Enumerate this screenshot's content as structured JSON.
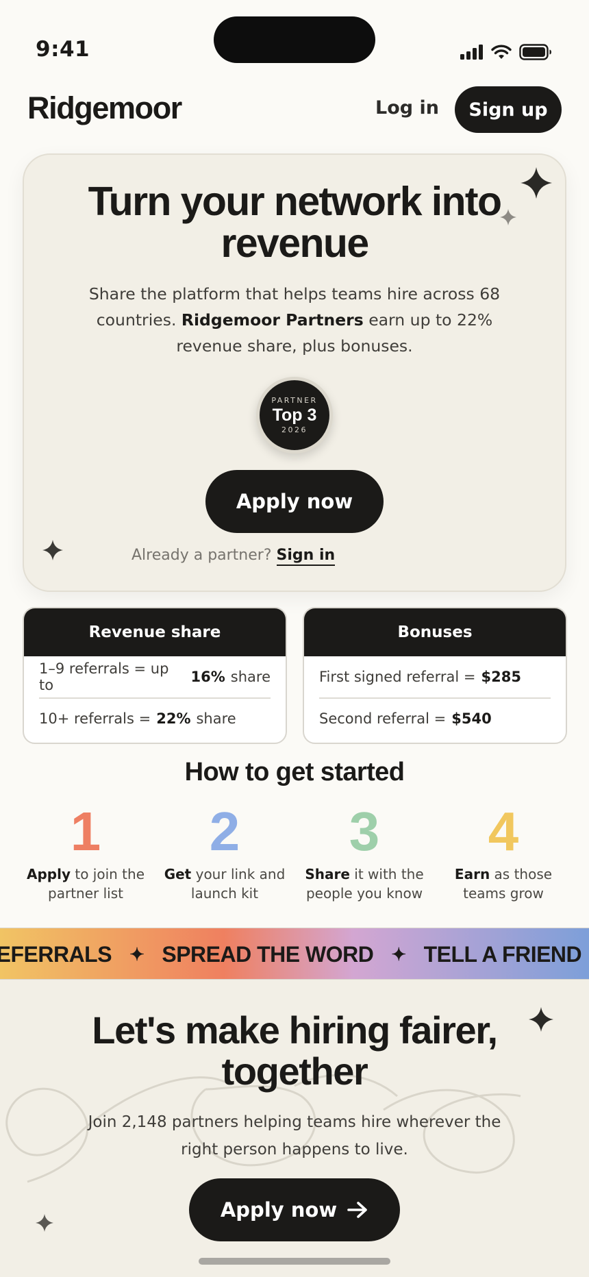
{
  "status": {
    "time": "9:41"
  },
  "header": {
    "logo": "Ridgemoor",
    "login": "Log in",
    "signup": "Sign up"
  },
  "hero": {
    "title_line1": "Turn your network into",
    "title_line2": "revenue",
    "desc_part1": "Share the platform that helps teams hire across 68 countries.",
    "desc_bold": "Ridgemoor Partners",
    "desc_part2": "earn up to 22% revenue share, plus bonuses.",
    "badge_top": "PARTNER",
    "badge_main": "Top 3",
    "badge_year": "2026",
    "apply": "Apply now",
    "already": "Already a partner?",
    "signin": "Sign in"
  },
  "cards": {
    "revenue": {
      "title": "Revenue share",
      "row1_pre": "1–9 referrals = up to",
      "row1_bold": "16%",
      "row1_post": "share",
      "row2_pre": "10+ referrals =",
      "row2_bold": "22%",
      "row2_post": "share"
    },
    "bonuses": {
      "title": "Bonuses",
      "row1_pre": "First signed referral =",
      "row1_bold": "$285",
      "row2_pre": "Second referral =",
      "row2_bold": "$540"
    }
  },
  "how": {
    "title": "How to get started",
    "steps": [
      {
        "num": "1",
        "bold": "Apply",
        "text": "to join the partner list",
        "color": "#ee7f63"
      },
      {
        "num": "2",
        "bold": "Get",
        "text": "your link and launch kit",
        "color": "#8faee6"
      },
      {
        "num": "3",
        "bold": "Share",
        "text": "it with the people you know",
        "color": "#9ecfaa"
      },
      {
        "num": "4",
        "bold": "Earn",
        "text": "as those teams grow",
        "color": "#f1c75e"
      }
    ]
  },
  "marquee": {
    "items": [
      "REFERRALS",
      "SPREAD THE WORD",
      "TELL A FRIEND"
    ]
  },
  "cta": {
    "title_line1": "Let's make hiring fairer,",
    "title_line2": "together",
    "desc": "Join 2,148 partners helping teams hire wherever the right person happens to live.",
    "apply": "Apply now"
  }
}
